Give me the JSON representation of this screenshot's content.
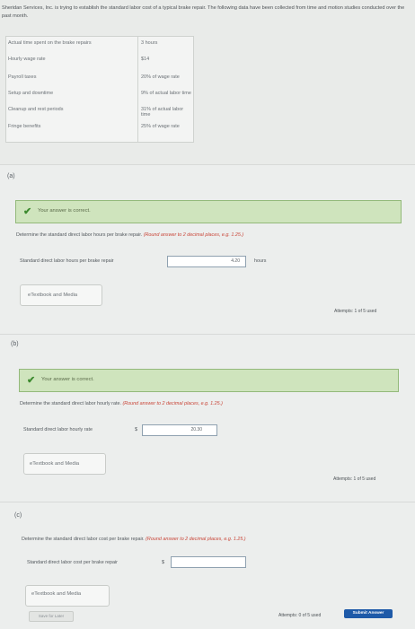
{
  "intro": "Sheridan Services, Inc. is trying to establish the standard labor cost of a typical brake repair. The following data have been collected from time and motion studies conducted over the past month.",
  "table": [
    {
      "label": "Actual time spent on the brake repairs",
      "value": "3 hours"
    },
    {
      "label": "Hourly wage rate",
      "value": "$14"
    },
    {
      "label": "Payroll taxes",
      "value": "20% of wage rate"
    },
    {
      "label": "Setup and downtime",
      "value": "9% of actual labor time"
    },
    {
      "label": "Cleanup and rest periods",
      "value": "31% of actual labor time"
    },
    {
      "label": "Fringe benefits",
      "value": "25% of wage rate"
    }
  ],
  "parts": {
    "a": {
      "tag": "(a)",
      "correct": "Your answer is correct.",
      "question": "Determine the standard direct labor hours per brake repair.",
      "hint": "(Round answer to 2 decimal places, e.g. 1.25.)",
      "field_label": "Standard direct labor hours per brake repair",
      "answer": "4.20",
      "unit": "hours",
      "etext": "eTextbook and Media",
      "attempts": "Attempts: 1 of 5 used"
    },
    "b": {
      "tag": "(b)",
      "correct": "Your answer is correct.",
      "question": "Determine the standard direct labor hourly rate.",
      "hint": "(Round answer to 2 decimal places, e.g. 1.25.)",
      "field_label": "Standard direct labor hourly rate",
      "currency": "$",
      "answer": "20.30",
      "etext": "eTextbook and Media",
      "attempts": "Attempts: 1 of 5 used"
    },
    "c": {
      "tag": "(c)",
      "question": "Determine the standard direct labor cost per brake repair.",
      "hint": "(Round answer to 2 decimal places, e.g. 1.25.)",
      "field_label": "Standard direct labor cost per brake repair",
      "currency": "$",
      "answer": "",
      "etext": "eTextbook and Media",
      "save": "Save for Later",
      "attempts": "Attempts: 0 of 5 used",
      "submit": "Submit Answer"
    }
  },
  "colors": {
    "correct_bg": "#cfe4bd",
    "submit": "#1e5aa8",
    "hint": "#c9473a"
  },
  "icons": {
    "correct": "check-icon"
  }
}
